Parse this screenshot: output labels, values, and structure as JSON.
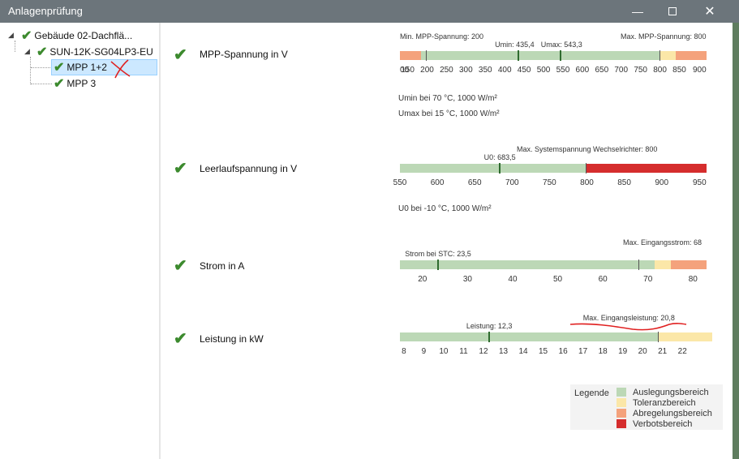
{
  "window": {
    "title": "Anlagenprüfung"
  },
  "colors": {
    "design": "#bcd8b6",
    "tolerance": "#fbe7a8",
    "curtail": "#f4a27c",
    "forbidden": "#d52d2d",
    "titlebar": "#6c757b",
    "check": "#3c8a2e"
  },
  "tree": {
    "items": [
      {
        "label": "Gebäude 02-Dachflä...",
        "level": 0,
        "expanded": true,
        "selected": false
      },
      {
        "label": "SUN-12K-SG04LP3-EU",
        "level": 1,
        "expanded": true,
        "selected": false
      },
      {
        "label": "MPP 1+2",
        "level": 2,
        "selected": true
      },
      {
        "label": "MPP 3",
        "level": 2,
        "selected": false
      }
    ]
  },
  "checks": [
    {
      "label": "MPP-Spannung in V",
      "gauge": {
        "min": 130,
        "max": 920,
        "ticks": [
          "00",
          "150",
          "200",
          "250",
          "300",
          "350",
          "400",
          "450",
          "500",
          "550",
          "600",
          "650",
          "700",
          "750",
          "800",
          "850",
          "900"
        ],
        "tick_values": [
          100,
          150,
          200,
          250,
          300,
          350,
          400,
          450,
          500,
          550,
          600,
          650,
          700,
          750,
          800,
          850,
          900
        ],
        "segments": [
          {
            "from": 130,
            "to": 185,
            "kind": "curtail"
          },
          {
            "from": 185,
            "to": 800,
            "kind": "design"
          },
          {
            "from": 800,
            "to": 840,
            "kind": "tolerance"
          },
          {
            "from": 840,
            "to": 920,
            "kind": "curtail"
          }
        ],
        "markers": [
          {
            "value": 200,
            "label": "Min. MPP-Spannung: 200",
            "thin": true
          },
          {
            "value": 435.4,
            "label": "Umin: 435,4"
          },
          {
            "value": 543.3,
            "label": "Umax: 543,3"
          },
          {
            "value": 800,
            "label": "Max. MPP-Spannung: 800",
            "thin": true
          }
        ]
      },
      "notes": [
        "Umin bei 70 °C, 1000 W/m²",
        "Umax bei 15 °C, 1000 W/m²"
      ]
    },
    {
      "label": "Leerlaufspannung in V",
      "gauge": {
        "min": 550,
        "max": 960,
        "ticks": [
          "550",
          "600",
          "650",
          "700",
          "750",
          "800",
          "850",
          "900",
          "950"
        ],
        "tick_values": [
          550,
          600,
          650,
          700,
          750,
          800,
          850,
          900,
          950
        ],
        "segments": [
          {
            "from": 550,
            "to": 800,
            "kind": "design"
          },
          {
            "from": 800,
            "to": 960,
            "kind": "forbidden"
          }
        ],
        "markers": [
          {
            "value": 683.5,
            "label": "U0: 683,5"
          },
          {
            "value": 800,
            "label": "Max. Systemspannung Wechselrichter: 800",
            "thin": true
          }
        ]
      },
      "notes": [
        "U0 bei -10 °C, 1000 W/m²"
      ]
    },
    {
      "label": "Strom in A",
      "gauge": {
        "min": 15,
        "max": 83,
        "ticks": [
          "20",
          "30",
          "40",
          "50",
          "60",
          "70",
          "80"
        ],
        "tick_values": [
          20,
          30,
          40,
          50,
          60,
          70,
          80
        ],
        "segments": [
          {
            "from": 15,
            "to": 71.5,
            "kind": "design"
          },
          {
            "from": 71.5,
            "to": 75,
            "kind": "tolerance"
          },
          {
            "from": 75,
            "to": 83,
            "kind": "curtail"
          }
        ],
        "markers": [
          {
            "value": 23.5,
            "label": "Strom bei STC: 23,5"
          },
          {
            "value": 68,
            "label": "Max. Eingangsstrom: 68",
            "thin": true
          }
        ]
      },
      "notes": []
    },
    {
      "label": "Leistung in kW",
      "gauge": {
        "min": 7.8,
        "max": 23.5,
        "ticks": [
          "8",
          "9",
          "10",
          "11",
          "12",
          "13",
          "14",
          "15",
          "16",
          "17",
          "18",
          "19",
          "20",
          "21",
          "22"
        ],
        "tick_values": [
          8,
          9,
          10,
          11,
          12,
          13,
          14,
          15,
          16,
          17,
          18,
          19,
          20,
          21,
          22
        ],
        "segments": [
          {
            "from": 7.8,
            "to": 20.8,
            "kind": "design"
          },
          {
            "from": 20.8,
            "to": 23.5,
            "kind": "tolerance"
          }
        ],
        "markers": [
          {
            "value": 12.3,
            "label": "Leistung: 12,3"
          },
          {
            "value": 20.8,
            "label": "Max. Eingangsleistung: 20,8",
            "thin": true
          }
        ]
      },
      "notes": []
    }
  ],
  "legend": {
    "title": "Legende",
    "items": [
      {
        "label": "Auslegungsbereich",
        "kind": "design"
      },
      {
        "label": "Toleranzbereich",
        "kind": "tolerance"
      },
      {
        "label": "Abregelungsbereich",
        "kind": "curtail"
      },
      {
        "label": "Verbotsbereich",
        "kind": "forbidden"
      }
    ]
  }
}
